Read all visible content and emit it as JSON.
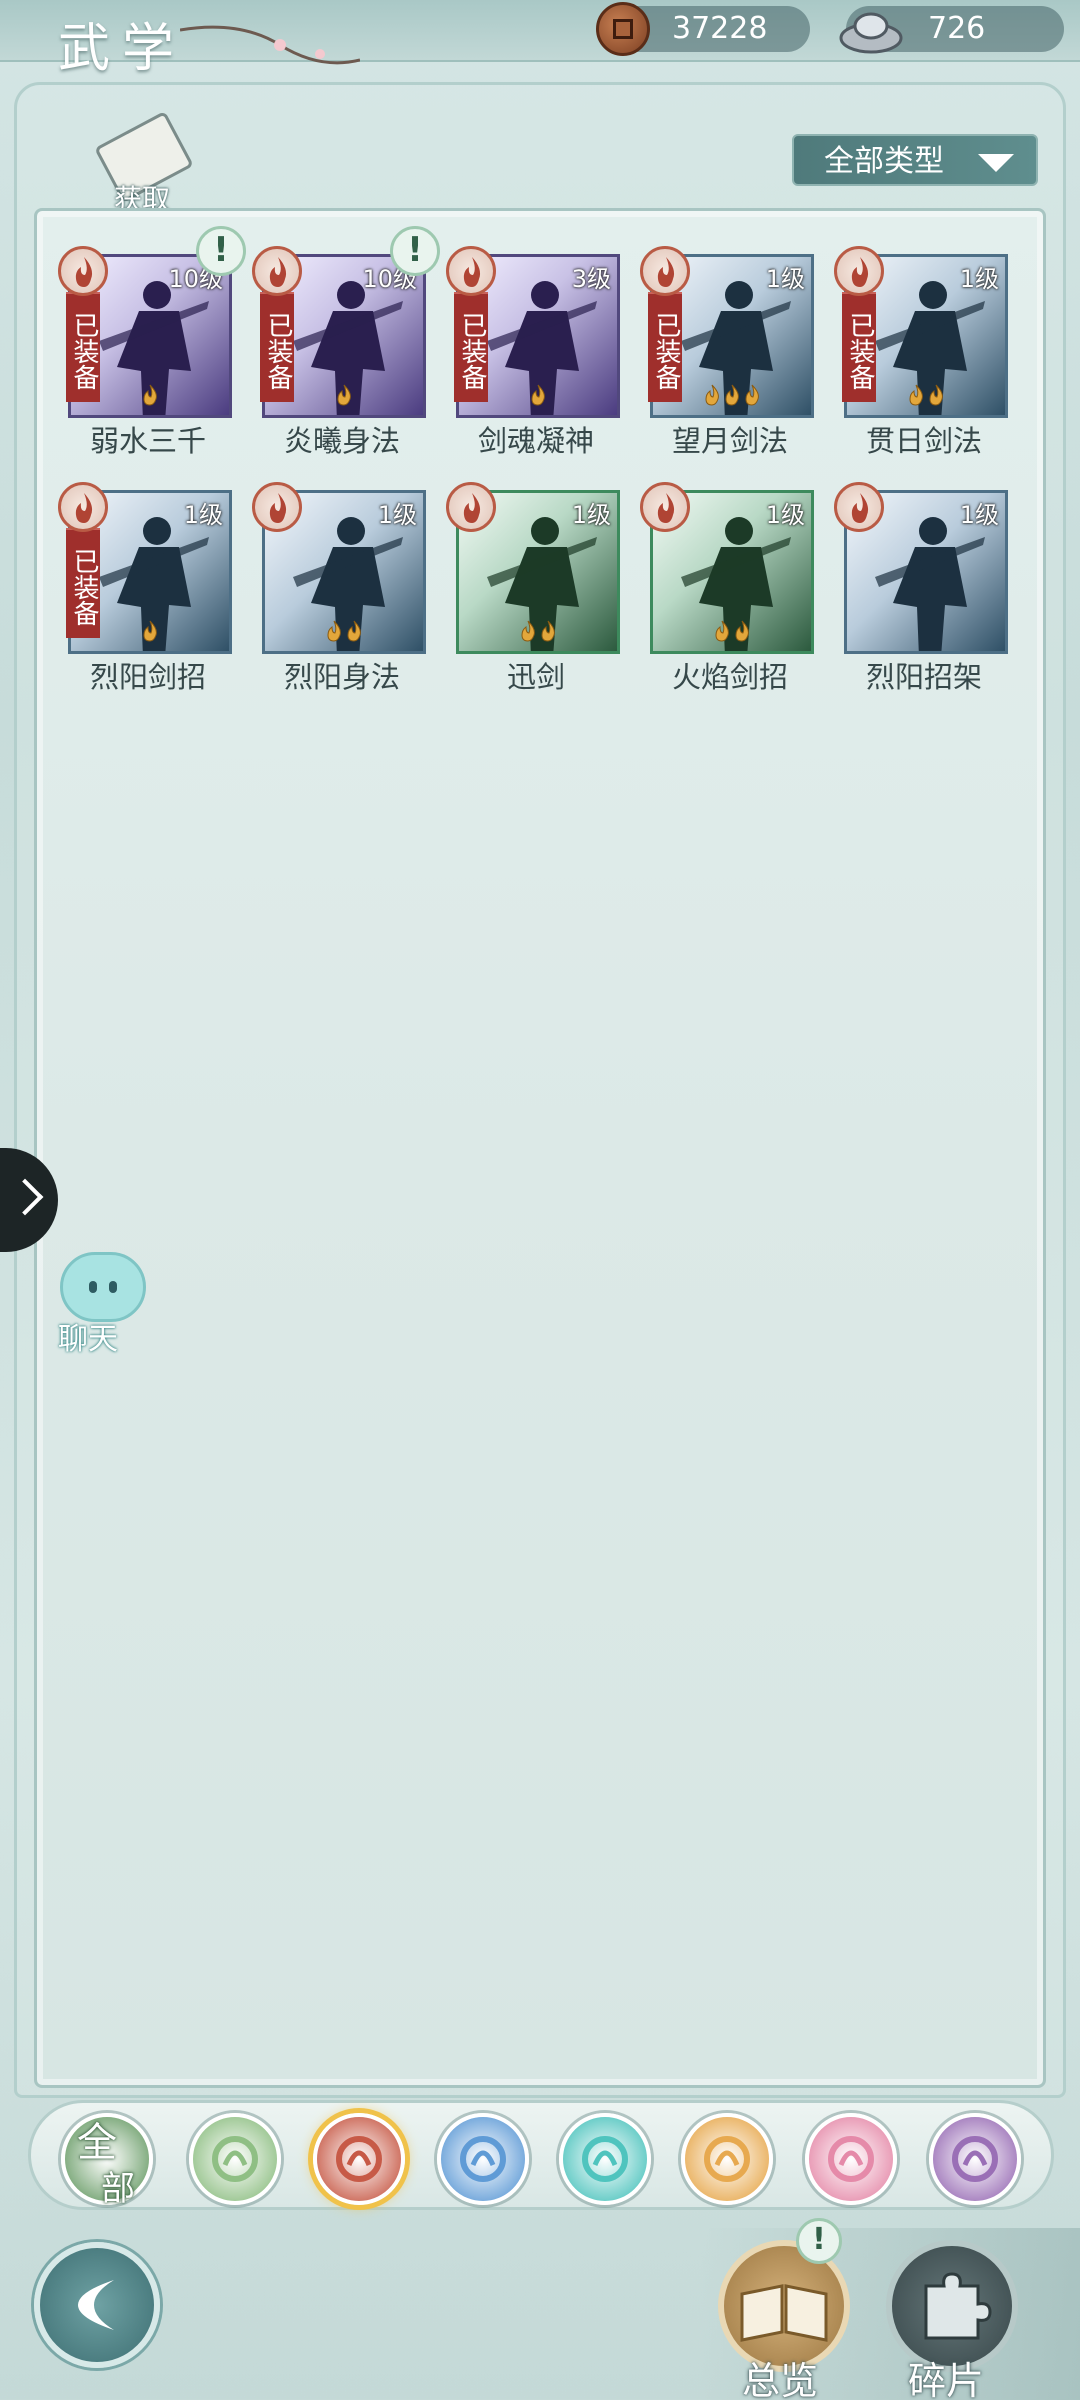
{
  "header": {
    "title": "武学",
    "copper": "37228",
    "silver": "726"
  },
  "toolbar": {
    "get_label": "获取",
    "type_filter": "全部类型"
  },
  "skills": [
    {
      "name": "弱水三千",
      "level": "10级",
      "equipped_label": "已装备",
      "equipped": true,
      "flames": 1,
      "style": "purple",
      "alert": "!"
    },
    {
      "name": "炎曦身法",
      "level": "10级",
      "equipped_label": "已装备",
      "equipped": true,
      "flames": 1,
      "style": "purple",
      "alert": "!"
    },
    {
      "name": "剑魂凝神",
      "level": "3级",
      "equipped_label": "已装备",
      "equipped": true,
      "flames": 1,
      "style": "purple"
    },
    {
      "name": "望月剑法",
      "level": "1级",
      "equipped_label": "已装备",
      "equipped": true,
      "flames": 3,
      "style": "blue"
    },
    {
      "name": "贯日剑法",
      "level": "1级",
      "equipped_label": "已装备",
      "equipped": true,
      "flames": 2,
      "style": "blue"
    },
    {
      "name": "烈阳剑招",
      "level": "1级",
      "equipped_label": "已装备",
      "equipped": true,
      "flames": 1,
      "style": "blue"
    },
    {
      "name": "烈阳身法",
      "level": "1级",
      "equipped": false,
      "flames": 2,
      "style": "blue"
    },
    {
      "name": "迅剑",
      "level": "1级",
      "equipped": false,
      "flames": 2,
      "style": "green"
    },
    {
      "name": "火焰剑招",
      "level": "1级",
      "equipped": false,
      "flames": 2,
      "style": "green"
    },
    {
      "name": "烈阳招架",
      "level": "1级",
      "equipped": false,
      "flames": 0,
      "style": "blue"
    }
  ],
  "sidebar": {
    "chat_label": "聊天"
  },
  "categories": [
    {
      "label_line1": "全",
      "label_line2": "部",
      "icon": "all-icon",
      "color": "#6c9e6a",
      "selected": false
    },
    {
      "icon": "leaf-sword-icon",
      "color": "#8fbf84",
      "selected": false
    },
    {
      "icon": "fire-sect-icon",
      "color": "#c75a47",
      "selected": true
    },
    {
      "icon": "wave-icon",
      "color": "#5f9bd6",
      "selected": false
    },
    {
      "icon": "butterfly-icon",
      "color": "#4fc4be",
      "selected": false
    },
    {
      "icon": "shield-icon",
      "color": "#e7a94f",
      "selected": false
    },
    {
      "icon": "moon-icon",
      "color": "#e58aa9",
      "selected": false
    },
    {
      "icon": "rose-icon",
      "color": "#9a6fb6",
      "selected": false
    }
  ],
  "bottom": {
    "overview_label": "总览",
    "shards_label": "碎片",
    "overview_alert": "!"
  },
  "colors": {
    "equipped_badge": "#9f2f2c",
    "flame": "#e3a73b",
    "selected_ring": "#f0c24a"
  }
}
